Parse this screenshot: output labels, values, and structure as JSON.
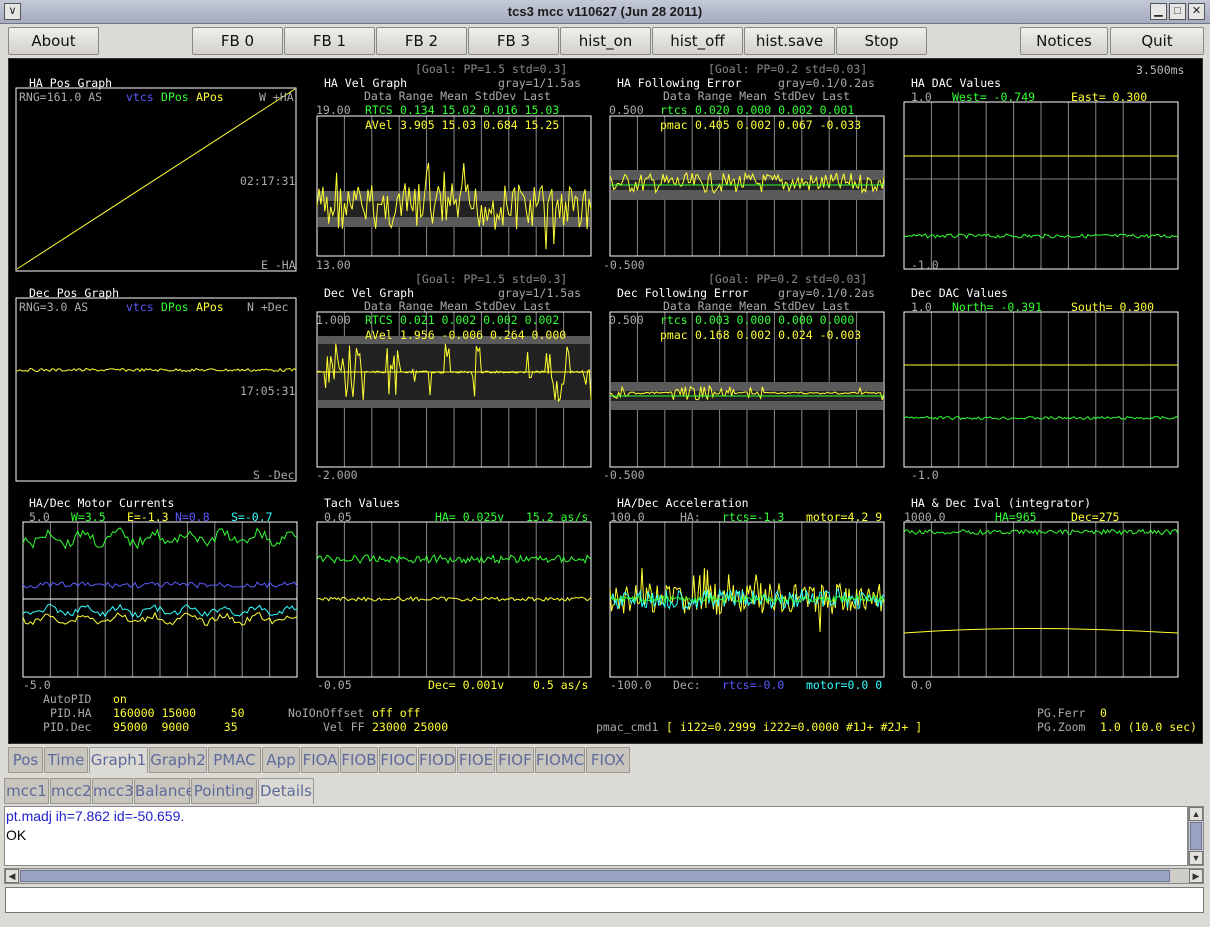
{
  "window": {
    "title": "tcs3 mcc v110627 (Jun 28 2011)"
  },
  "toolbar": {
    "about": "About",
    "fb0": "FB 0",
    "fb1": "FB 1",
    "fb2": "FB 2",
    "fb3": "FB 3",
    "hist_on": "hist_on",
    "hist_off": "hist_off",
    "hist_save": "hist.save",
    "stop": "Stop",
    "notices": "Notices",
    "quit": "Quit"
  },
  "colors": {
    "yellow": "#ffff33",
    "green": "#33ff33",
    "blue": "#5a5aff",
    "cyan": "#33ffff",
    "gray": "#888888",
    "white": "#ffffff",
    "bg": "#000000",
    "band": "#5a5a5a"
  },
  "panel": {
    "time_ms": "3.500ms",
    "ha_pos": {
      "title": "HA Pos Graph",
      "rng": "RNG=161.0 AS",
      "vtcs": "vtcs",
      "dpos": "DPos",
      "apos": "APos",
      "top_right": "W +HA",
      "time": "02:17:31",
      "bottom_right": "E -HA"
    },
    "dec_pos": {
      "title": "Dec Pos Graph",
      "rng": "RNG=3.0 AS",
      "vtcs": "vtcs",
      "dpos": "DPos",
      "apos": "APos",
      "top_right": "N +Dec",
      "time": "17:05:31",
      "bottom_right": "S -Dec"
    },
    "ha_vel": {
      "goal": "[Goal: PP=1.5 std=0.3]",
      "title": "HA  Vel Graph",
      "gray_note": "gray=1/1.5as",
      "hdr": "Data Range   Mean StdDev   Last",
      "ymax": "19.00",
      "ymin": "13.00",
      "row1_label": "RTCS",
      "row1": "0.134  15.02  0.016  15.03",
      "row2_label": "AVel",
      "row2": "3.905  15.03  0.684  15.25"
    },
    "ha_ferr": {
      "goal": "[Goal: PP=0.2 std=0.03]",
      "title": "HA Following Error",
      "gray_note": "gray=0.1/0.2as",
      "hdr": "Data Range   Mean StdDev   Last",
      "ymax": "0.500",
      "ymin": "-0.500",
      "row1_label": "rtcs",
      "row1": "0.020  0.000  0.002  0.001",
      "row2_label": "pmac",
      "row2": "0.405  0.002  0.067 -0.033"
    },
    "ha_dac": {
      "title": "HA  DAC Values",
      "ymax": "1.0",
      "ymin": "-1.0",
      "west": "West= -0.749",
      "east": "East=  0.300"
    },
    "dec_vel": {
      "goal": "[Goal: PP=1.5 std=0.3]",
      "title": "Dec Vel Graph",
      "gray_note": "gray=1/1.5as",
      "hdr": "Data Range   Mean StdDev   Last",
      "ymax": "1.000",
      "ymin": "-2.000",
      "row1_label": "RTCS",
      "row1": "0.021  0.002  0.002  0.002",
      "row2_label": "AVel",
      "row2": "1.956 -0.006  0.264  0.000"
    },
    "dec_ferr": {
      "goal": "[Goal: PP=0.2 std=0.03]",
      "title": "Dec Following Error",
      "gray_note": "gray=0.1/0.2as",
      "hdr": "Data Range   Mean StdDev   Last",
      "ymax": "0.500",
      "ymin": "-0.500",
      "row1_label": "rtcs",
      "row1": "0.003  0.000  0.000  0.000",
      "row2_label": "pmac",
      "row2": "0.168  0.002  0.024 -0.003"
    },
    "dec_dac": {
      "title": "Dec DAC Values",
      "ymax": "1.0",
      "ymin": "-1.0",
      "north": "North= -0.391",
      "south": "South=  0.300"
    },
    "currents": {
      "title": "HA/Dec Motor Currents",
      "ymax": "5.0",
      "ymin": "-5.0",
      "w": "W=3.5",
      "e": "E=-1.3",
      "n": "N=0.8",
      "s": "S=-0.7"
    },
    "tach": {
      "title": "Tach Values",
      "ymax": "0.05",
      "ymin": "-0.05",
      "ha": "HA= 0.025v",
      "ha_as": "15.2 as/s",
      "dec": "Dec= 0.001v",
      "dec_as": "0.5 as/s"
    },
    "accel": {
      "title": "HA/Dec Acceleration",
      "ymax": "100.0",
      "ymin": "-100.0",
      "ha_label": "HA:",
      "ha_rtcs": "rtcs=-1.3",
      "ha_motor": "motor=4.2 9",
      "dec_label": "Dec:",
      "dec_rtcs": "rtcs=-0.0",
      "dec_motor": "motor=0.0 0"
    },
    "ival": {
      "title": "HA & Dec Ival (integrator)",
      "ymax": "1000.0",
      "ymin": "0.0",
      "ha": "HA=965",
      "dec": "Dec=275"
    },
    "footer": {
      "autopid_label": "AutoPID",
      "autopid_value": "on",
      "pidha_label": "PID.HA",
      "pidha_value": "160000 15000     50",
      "piddec_label": "PID.Dec",
      "piddec_value": "95000  9000     35",
      "noi_label": "NoIOnOffset",
      "noi_value": "off off",
      "velff_label": "Vel FF",
      "velff_value": "23000 25000",
      "pmac_label": "pmac_cmd1",
      "pmac_value": "[ i122=0.2999 i222=0.0000 #1J+ #2J+ ]",
      "pgferr_label": "PG.Ferr",
      "pgferr_value": "0",
      "pgzoom_label": "PG.Zoom",
      "pgzoom_value": "1.0 (10.0 sec)"
    }
  },
  "tabs_row1": [
    "Pos",
    "Time",
    "Graph1",
    "Graph2",
    "PMAC",
    "App",
    "FIOA",
    "FIOB",
    "FIOC",
    "FIOD",
    "FIOE",
    "FIOF",
    "FIOMC",
    "FIOX"
  ],
  "tabs_row2": [
    "mcc1",
    "mcc2",
    "mcc3",
    "Balance",
    "Pointing",
    "Details"
  ],
  "log": {
    "line1": "pt.madj ih=7.862 id=-50.659.",
    "line2": "OK"
  },
  "command": {
    "value": ""
  }
}
